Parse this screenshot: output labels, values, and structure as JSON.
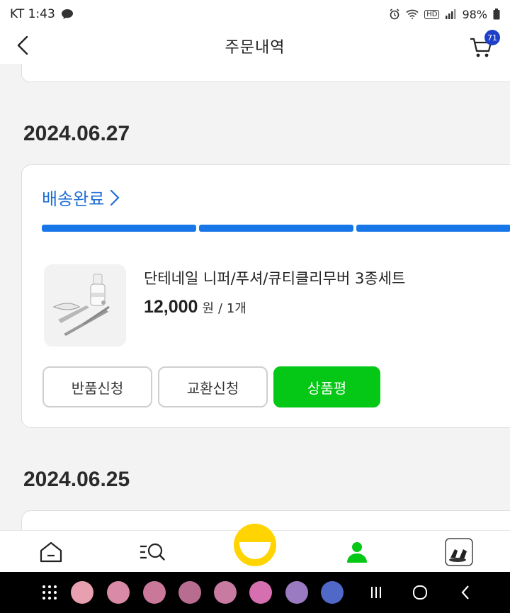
{
  "status_bar": {
    "carrier_time": "KT 1:43",
    "battery": "98%",
    "hd_label": "HD"
  },
  "header": {
    "title": "주문내역",
    "cart_count": "71"
  },
  "orders": [
    {
      "date": "2024.06.27",
      "status": "배송완료",
      "product": {
        "name": "단테네일 니퍼/푸셔/큐티클리무버 3종세트",
        "price": "12,000",
        "currency": "원",
        "quantity": "/ 1개"
      },
      "actions": {
        "return_label": "반품신청",
        "exchange_label": "교환신청",
        "review_label": "상품평"
      }
    },
    {
      "date": "2024.06.25"
    }
  ],
  "colors": {
    "accent_blue": "#1877e8",
    "review_green": "#05c716",
    "cart_badge": "#1e40c8",
    "center_tab": "#ffd400"
  },
  "bottom_nav": {
    "icons": [
      "home-icon",
      "search-list-icon",
      "smile-face-icon",
      "my-page-person-icon",
      "recent-product-icon"
    ]
  }
}
